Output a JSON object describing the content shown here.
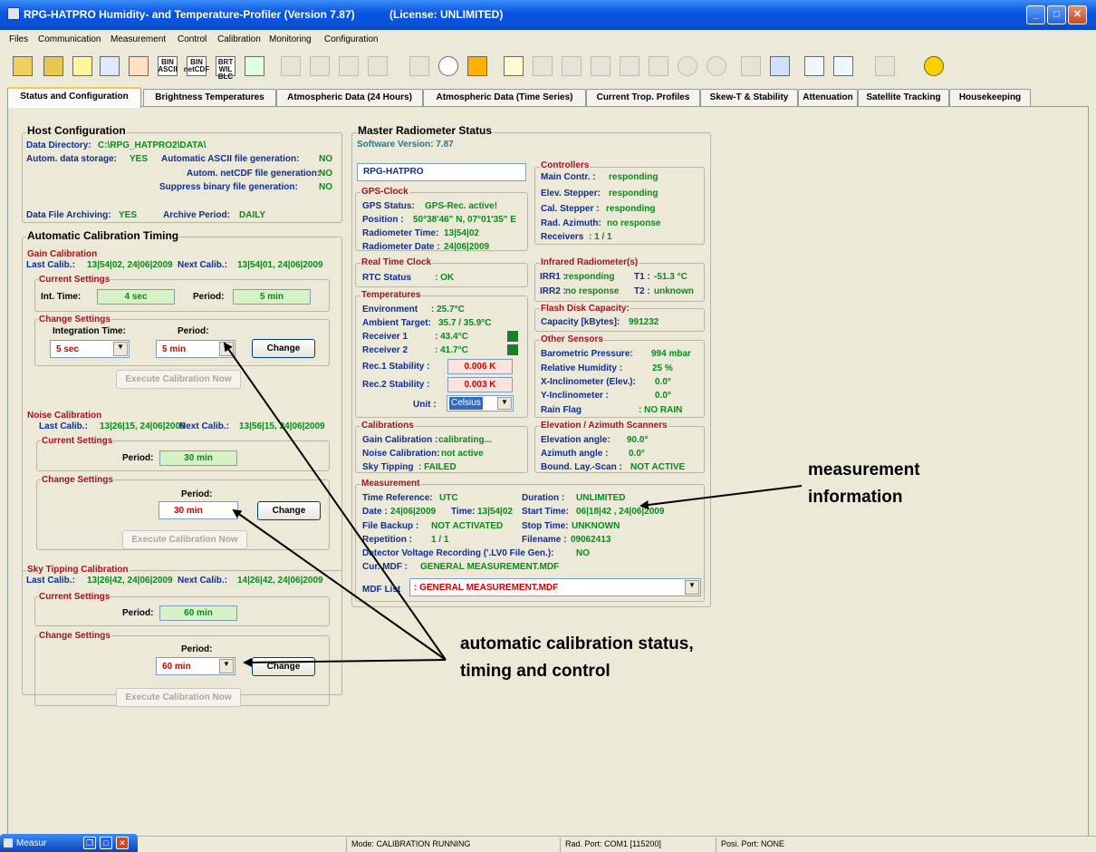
{
  "window": {
    "title": "RPG-HATPRO Humidity- and Temperature-Profiler (Version 7.87)",
    "license": "(License: UNLIMITED)"
  },
  "menu": [
    "Files",
    "Communication",
    "Measurement",
    "Control",
    "Calibration",
    "Monitoring",
    "Configuration"
  ],
  "toolbar_labels": {
    "bin_ascii": "BIN ASCII",
    "bin_netcdf": "BIN netCDF",
    "brt_wilblc": "BRT WIL BLC"
  },
  "tabs": [
    "Status and Configuration",
    "Brightness Temperatures",
    "Atmospheric Data (24 Hours)",
    "Atmospheric Data (Time Series)",
    "Current Trop. Profiles",
    "Skew-T & Stability",
    "Attenuation",
    "Satellite Tracking",
    "Housekeeping"
  ],
  "host": {
    "title": "Host Configuration",
    "data_dir_label": "Data Directory:",
    "data_dir": "C:\\RPG_HATPRO2\\DATA\\",
    "storage_label": "Autom. data storage:",
    "storage": "YES",
    "ascii_label": "Automatic ASCII file generation:",
    "ascii": "NO",
    "netcdf_label": "Autom. netCDF file generation:",
    "netcdf": "NO",
    "binary_label": "Suppress binary file generation:",
    "binary": "NO",
    "archiving_label": "Data File Archiving:",
    "archiving": "YES",
    "period_label": "Archive Period:",
    "period": "DAILY"
  },
  "auto_cal": {
    "title": "Automatic Calibration Timing",
    "gain": {
      "title": "Gain Calibration",
      "last_label": "Last Calib.:",
      "last": "13|54|02, 24|06|2009",
      "next_label": "Next Calib.:",
      "next": "13|54|01, 24|06|2009",
      "current": "Current Settings",
      "int_time_label": "Int. Time:",
      "int_time": "4 sec",
      "period_label": "Period:",
      "period": "5 min",
      "change": "Change Settings",
      "integration_label": "Integration Time:",
      "period2_label": "Period:",
      "sel_int": "5 sec",
      "sel_period": "5 min",
      "change_btn": "Change",
      "execute": "Execute Calibration Now"
    },
    "noise": {
      "title": "Noise Calibration",
      "last_label": "Last Calib.:",
      "last": "13|26|15, 24|06|2009",
      "next_label": "Next Calib.:",
      "next": "13|56|15, 24|06|2009",
      "current": "Current Settings",
      "period_label": "Period:",
      "period": "30 min",
      "change": "Change Settings",
      "period2_label": "Period:",
      "sel_period": "30 min",
      "change_btn": "Change",
      "execute": "Execute Calibration Now"
    },
    "sky": {
      "title": "Sky Tipping Calibration",
      "last_label": "Last Calib.:",
      "last": "13|26|42, 24|06|2009",
      "next_label": "Next Calib.:",
      "next": "14|26|42, 24|06|2009",
      "current": "Current Settings",
      "period_label": "Period:",
      "period": "60 min",
      "change": "Change Settings",
      "period2_label": "Period:",
      "sel_period": "60 min",
      "change_btn": "Change",
      "execute": "Execute Calibration Now"
    }
  },
  "master": {
    "title": "Master Radiometer Status",
    "software": "Software Version: 7.87",
    "radiometer_name": "RPG-HATPRO",
    "gps": {
      "title": "GPS-Clock",
      "status_label": "GPS Status:",
      "status": "GPS-Rec. active!",
      "position_label": "Position :",
      "position": "50°38'46\" N, 07°01'35\" E",
      "time_label": "Radiometer Time:",
      "time": "13|54|02",
      "date_label": "Radiometer Date :",
      "date": "24|06|2009"
    },
    "rtc": {
      "title": "Real Time Clock",
      "status_label": "RTC Status",
      "status": ":  OK"
    },
    "temps": {
      "title": "Temperatures",
      "env_label": "Environment",
      "env": ":  25.7°C",
      "amb_label": "Ambient Target:",
      "amb": "35.7 /  35.9°C",
      "rec1_label": "Receiver 1",
      "rec1": ":  43.4°C",
      "rec2_label": "Receiver 2",
      "rec2": ":  41.7°C",
      "stab1_label": "Rec.1 Stability   :",
      "stab1": "0.006 K",
      "stab2_label": "Rec.2 Stability   :",
      "stab2": "0.003 K",
      "unit_label": "Unit  :",
      "unit": "Celsius"
    },
    "controllers": {
      "title": "Controllers",
      "rows": [
        [
          "Main Contr.  :",
          "responding"
        ],
        [
          "Elev. Stepper:",
          "responding"
        ],
        [
          "Cal. Stepper :",
          "responding"
        ],
        [
          "Rad. Azimuth:",
          "no response"
        ],
        [
          "Receivers",
          ":  1 / 1"
        ]
      ]
    },
    "infrared": {
      "title": "Infrared Radiometer(s)",
      "irr1_label": "IRR1 :",
      "irr1": "responding",
      "t1_label": "T1 :",
      "t1": "-51.3 °C",
      "irr2_label": "IRR2 :",
      "irr2": "no response",
      "t2_label": "T2 :",
      "t2": "unknown"
    },
    "flash": {
      "title": "Flash Disk Capacity:",
      "label": "Capacity [kBytes]:",
      "value": "991232"
    },
    "other": {
      "title": "Other Sensors",
      "rows": [
        [
          "Barometric Pressure:",
          "994 mbar"
        ],
        [
          "Relative Humidity    :",
          "25 %"
        ],
        [
          "X-Inclinometer (Elev.):",
          "0.0°"
        ],
        [
          "Y-Inclinometer         :",
          "0.0°"
        ],
        [
          "Rain Flag",
          ":  NO RAIN"
        ]
      ]
    },
    "calibrations": {
      "title": "Calibrations",
      "rows": [
        [
          "Gain Calibration  :",
          "calibrating..."
        ],
        [
          "Noise Calibration:",
          "not active"
        ],
        [
          "Sky Tipping",
          ":  FAILED"
        ]
      ]
    },
    "scanners": {
      "title": "Elevation / Azimuth Scanners",
      "rows": [
        [
          "Elevation angle:",
          "90.0°"
        ],
        [
          "Azimuth angle  :",
          "0.0°"
        ],
        [
          "Bound. Lay.-Scan :",
          "NOT ACTIVE"
        ]
      ]
    },
    "measurement": {
      "title": "Measurement",
      "timeref_label": "Time Reference:",
      "timeref": "UTC",
      "duration_label": "Duration  :",
      "duration": "UNLIMITED",
      "date_label": "Date : ",
      "date": "24|06|2009",
      "time_label": "Time:",
      "time": "13|54|02",
      "start_label": "Start Time:",
      "start": "06|18|42 , 24|06|2009",
      "backup_label": "File Backup  :",
      "backup": "NOT ACTIVATED",
      "stop_label": "Stop Time:",
      "stop": "UNKNOWN",
      "rep_label": "Repetition   :",
      "rep": "1 / 1",
      "filename_label": "Filename :",
      "filename": "09062413",
      "lv0_label": "Detector Voltage Recording ('.LV0 File Gen.):",
      "lv0": "NO",
      "mdf_label": "Cur. MDF    :",
      "mdf": "GENERAL MEASUREMENT.MDF",
      "mdflist_label": "MDF List",
      "mdflist": ":  GENERAL MEASUREMENT.MDF"
    }
  },
  "annotations": {
    "measurement": [
      "measurement",
      "information"
    ],
    "calibration": [
      "automatic calibration status,",
      "timing and control"
    ]
  },
  "statusbar": {
    "mini_title": "Measur",
    "mode": "Mode: CALIBRATION RUNNING",
    "rad_port": "Rad. Port: COM1 [115200]",
    "posi_port": "Posi. Port: NONE"
  }
}
